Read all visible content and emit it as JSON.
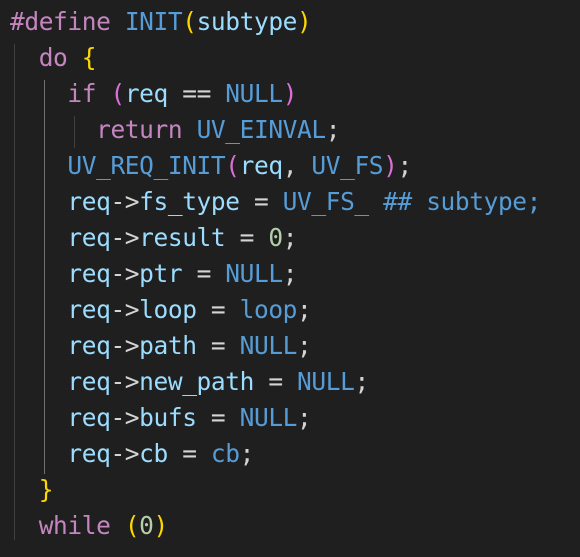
{
  "lines": [
    {
      "tokens": [
        {
          "t": "#define",
          "c": "c-macro"
        },
        {
          "t": " ",
          "c": "c-plain"
        },
        {
          "t": "INIT",
          "c": "c-define-name"
        },
        {
          "t": "(",
          "c": "c-paren1"
        },
        {
          "t": "subtype",
          "c": "c-param"
        },
        {
          "t": ")",
          "c": "c-paren1"
        }
      ]
    },
    {
      "tokens": [
        {
          "t": "  do ",
          "c": "c-keyword"
        },
        {
          "t": "{",
          "c": "c-paren1"
        }
      ]
    },
    {
      "tokens": [
        {
          "t": "    if ",
          "c": "c-keyword"
        },
        {
          "t": "(",
          "c": "c-paren2"
        },
        {
          "t": "req",
          "c": "c-var"
        },
        {
          "t": " == ",
          "c": "c-op"
        },
        {
          "t": "NULL",
          "c": "c-const"
        },
        {
          "t": ")",
          "c": "c-paren2"
        }
      ]
    },
    {
      "tokens": [
        {
          "t": "      return ",
          "c": "c-keyword"
        },
        {
          "t": "UV_EINVAL",
          "c": "c-const"
        },
        {
          "t": ";",
          "c": "c-plain"
        }
      ]
    },
    {
      "tokens": [
        {
          "t": "    ",
          "c": "c-plain"
        },
        {
          "t": "UV_REQ_INIT",
          "c": "c-macro-call"
        },
        {
          "t": "(",
          "c": "c-paren2"
        },
        {
          "t": "req",
          "c": "c-var"
        },
        {
          "t": ", ",
          "c": "c-plain"
        },
        {
          "t": "UV_FS",
          "c": "c-const"
        },
        {
          "t": ")",
          "c": "c-paren2"
        },
        {
          "t": ";",
          "c": "c-plain"
        }
      ]
    },
    {
      "tokens": [
        {
          "t": "    req",
          "c": "c-var"
        },
        {
          "t": "->",
          "c": "c-op"
        },
        {
          "t": "fs_type",
          "c": "c-var"
        },
        {
          "t": " = ",
          "c": "c-op"
        },
        {
          "t": "UV_FS_",
          "c": "c-const"
        },
        {
          "t": " ## ",
          "c": "c-const"
        },
        {
          "t": "subtype",
          "c": "c-const"
        },
        {
          "t": ";",
          "c": "c-const"
        }
      ]
    },
    {
      "tokens": [
        {
          "t": "    req",
          "c": "c-var"
        },
        {
          "t": "->",
          "c": "c-op"
        },
        {
          "t": "result",
          "c": "c-var"
        },
        {
          "t": " = ",
          "c": "c-op"
        },
        {
          "t": "0",
          "c": "c-num"
        },
        {
          "t": ";",
          "c": "c-plain"
        }
      ]
    },
    {
      "tokens": [
        {
          "t": "    req",
          "c": "c-var"
        },
        {
          "t": "->",
          "c": "c-op"
        },
        {
          "t": "ptr",
          "c": "c-var"
        },
        {
          "t": " = ",
          "c": "c-op"
        },
        {
          "t": "NULL",
          "c": "c-const"
        },
        {
          "t": ";",
          "c": "c-plain"
        }
      ]
    },
    {
      "tokens": [
        {
          "t": "    req",
          "c": "c-var"
        },
        {
          "t": "->",
          "c": "c-op"
        },
        {
          "t": "loop",
          "c": "c-var"
        },
        {
          "t": " = ",
          "c": "c-op"
        },
        {
          "t": "loop",
          "c": "c-const"
        },
        {
          "t": ";",
          "c": "c-plain"
        }
      ]
    },
    {
      "tokens": [
        {
          "t": "    req",
          "c": "c-var"
        },
        {
          "t": "->",
          "c": "c-op"
        },
        {
          "t": "path",
          "c": "c-var"
        },
        {
          "t": " = ",
          "c": "c-op"
        },
        {
          "t": "NULL",
          "c": "c-const"
        },
        {
          "t": ";",
          "c": "c-plain"
        }
      ]
    },
    {
      "tokens": [
        {
          "t": "    req",
          "c": "c-var"
        },
        {
          "t": "->",
          "c": "c-op"
        },
        {
          "t": "new_path",
          "c": "c-var"
        },
        {
          "t": " = ",
          "c": "c-op"
        },
        {
          "t": "NULL",
          "c": "c-const"
        },
        {
          "t": ";",
          "c": "c-plain"
        }
      ]
    },
    {
      "tokens": [
        {
          "t": "    req",
          "c": "c-var"
        },
        {
          "t": "->",
          "c": "c-op"
        },
        {
          "t": "bufs",
          "c": "c-var"
        },
        {
          "t": " = ",
          "c": "c-op"
        },
        {
          "t": "NULL",
          "c": "c-const"
        },
        {
          "t": ";",
          "c": "c-plain"
        }
      ]
    },
    {
      "tokens": [
        {
          "t": "    req",
          "c": "c-var"
        },
        {
          "t": "->",
          "c": "c-op"
        },
        {
          "t": "cb",
          "c": "c-var"
        },
        {
          "t": " = ",
          "c": "c-op"
        },
        {
          "t": "cb",
          "c": "c-const"
        },
        {
          "t": ";",
          "c": "c-plain"
        }
      ]
    },
    {
      "tokens": [
        {
          "t": "  ",
          "c": "c-plain"
        },
        {
          "t": "}",
          "c": "c-paren1"
        }
      ]
    },
    {
      "tokens": [
        {
          "t": "  while ",
          "c": "c-keyword"
        },
        {
          "t": "(",
          "c": "c-paren1"
        },
        {
          "t": "0",
          "c": "c-num"
        },
        {
          "t": ")",
          "c": "c-paren1"
        }
      ]
    }
  ]
}
